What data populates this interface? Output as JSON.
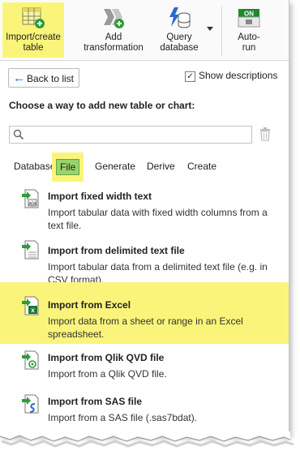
{
  "ribbon": {
    "buttons": [
      {
        "label": "Import/create table",
        "line1": "Import/create",
        "line2": "table"
      },
      {
        "label": "Add transformation",
        "line1": "Add",
        "line2": "transformation"
      },
      {
        "label": "Query database",
        "line1": "Query",
        "line2": "database"
      },
      {
        "label": "Auto-run",
        "line1": "Auto-",
        "line2": "run",
        "toggle_text": "ON"
      }
    ]
  },
  "nav": {
    "back_label": "Back to list",
    "show_descriptions_label": "Show descriptions",
    "show_descriptions_checked": true
  },
  "heading": "Choose a way to add new table or chart:",
  "search": {
    "value": "",
    "placeholder": ""
  },
  "tabs": [
    {
      "label": "Database"
    },
    {
      "label": "File",
      "selected": true
    },
    {
      "label": "Generate"
    },
    {
      "label": "Derive"
    },
    {
      "label": "Create"
    }
  ],
  "items": [
    {
      "title": "Import fixed width text",
      "desc": "Import tabular data with fixed width columns from a text file.",
      "icon": "fixed-width-text-icon"
    },
    {
      "title": "Import from delimited text file",
      "desc": "Import tabular data from a delimited text file (e.g. in CSV format).",
      "icon": "delimited-text-icon"
    },
    {
      "title": "Import from Excel",
      "desc": "Import data from a sheet or range in an Excel spreadsheet.",
      "icon": "excel-icon"
    },
    {
      "title": "Import from Qlik QVD file",
      "desc": "Import from a Qlik QVD file.",
      "icon": "qvd-icon"
    },
    {
      "title": "Import from SAS file",
      "desc": "Import from a SAS file (.sas7bdat).",
      "icon": "sas-icon"
    }
  ],
  "colors": {
    "highlight": "#faf57a",
    "tab_selected": "#9ad36a",
    "accent_green": "#2e9b3a",
    "accent_blue": "#2a69c9"
  }
}
